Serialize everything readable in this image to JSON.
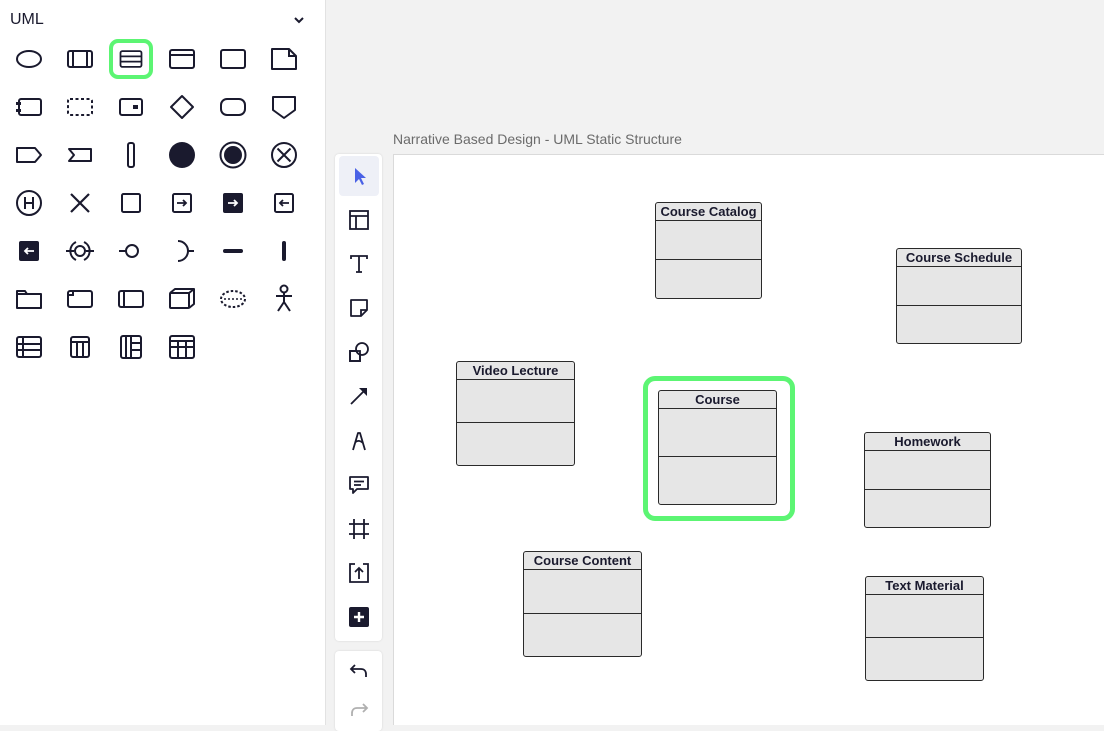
{
  "panel": {
    "title": "UML",
    "shapes": [
      "ellipse-icon",
      "class-icon",
      "class-attributes-icon",
      "header-box-icon",
      "rectangle-icon",
      "note-icon",
      "component-icon",
      "dashed-rectangle-icon",
      "port-box-icon",
      "decision-diamond-icon",
      "rounded-rectangle-icon",
      "pentagon-icon",
      "signal-send-icon",
      "signal-receive-icon",
      "vertical-bar-icon",
      "initial-state-icon",
      "final-state-icon",
      "terminate-icon",
      "history-state-icon",
      "cross-icon",
      "square-icon",
      "entry-point-icon",
      "exit-point-filled-icon",
      "exit-point-icon",
      "exit-filled-icon",
      "provided-required-interface-icon",
      "lollipop-interface-icon",
      "required-interface-icon",
      "horizontal-bar-icon",
      "thin-vertical-bar-icon",
      "package-icon",
      "tab-folder-icon",
      "box-with-tab-icon",
      "3d-box-icon",
      "use-case-dashed-icon",
      "actor-icon",
      "table-row-icon",
      "table-column-icon",
      "table-header-icon",
      "table-grid-icon"
    ],
    "selected_index": 2
  },
  "toolbar": {
    "tools": [
      "select-pointer-icon",
      "container-layout-icon",
      "text-icon",
      "sticky-note-icon",
      "shapes-icon",
      "line-arrow-icon",
      "pen-icon",
      "comment-icon",
      "frame-icon",
      "upload-icon",
      "add-more-icon"
    ],
    "active_index": 0,
    "history": [
      "undo-icon",
      "redo-icon"
    ]
  },
  "canvas": {
    "title": "Narrative Based Design - UML Static Structure",
    "selected_class": "Course",
    "classes": [
      {
        "name": "Course Catalog"
      },
      {
        "name": "Course Schedule"
      },
      {
        "name": "Video Lecture"
      },
      {
        "name": "Course"
      },
      {
        "name": "Homework"
      },
      {
        "name": "Course Content"
      },
      {
        "name": "Text Material"
      }
    ]
  },
  "colors": {
    "accent": "#5cf573",
    "icon": "#1a1a2e",
    "pointer": "#4a62e6",
    "class_fill": "#e6e6e6"
  }
}
